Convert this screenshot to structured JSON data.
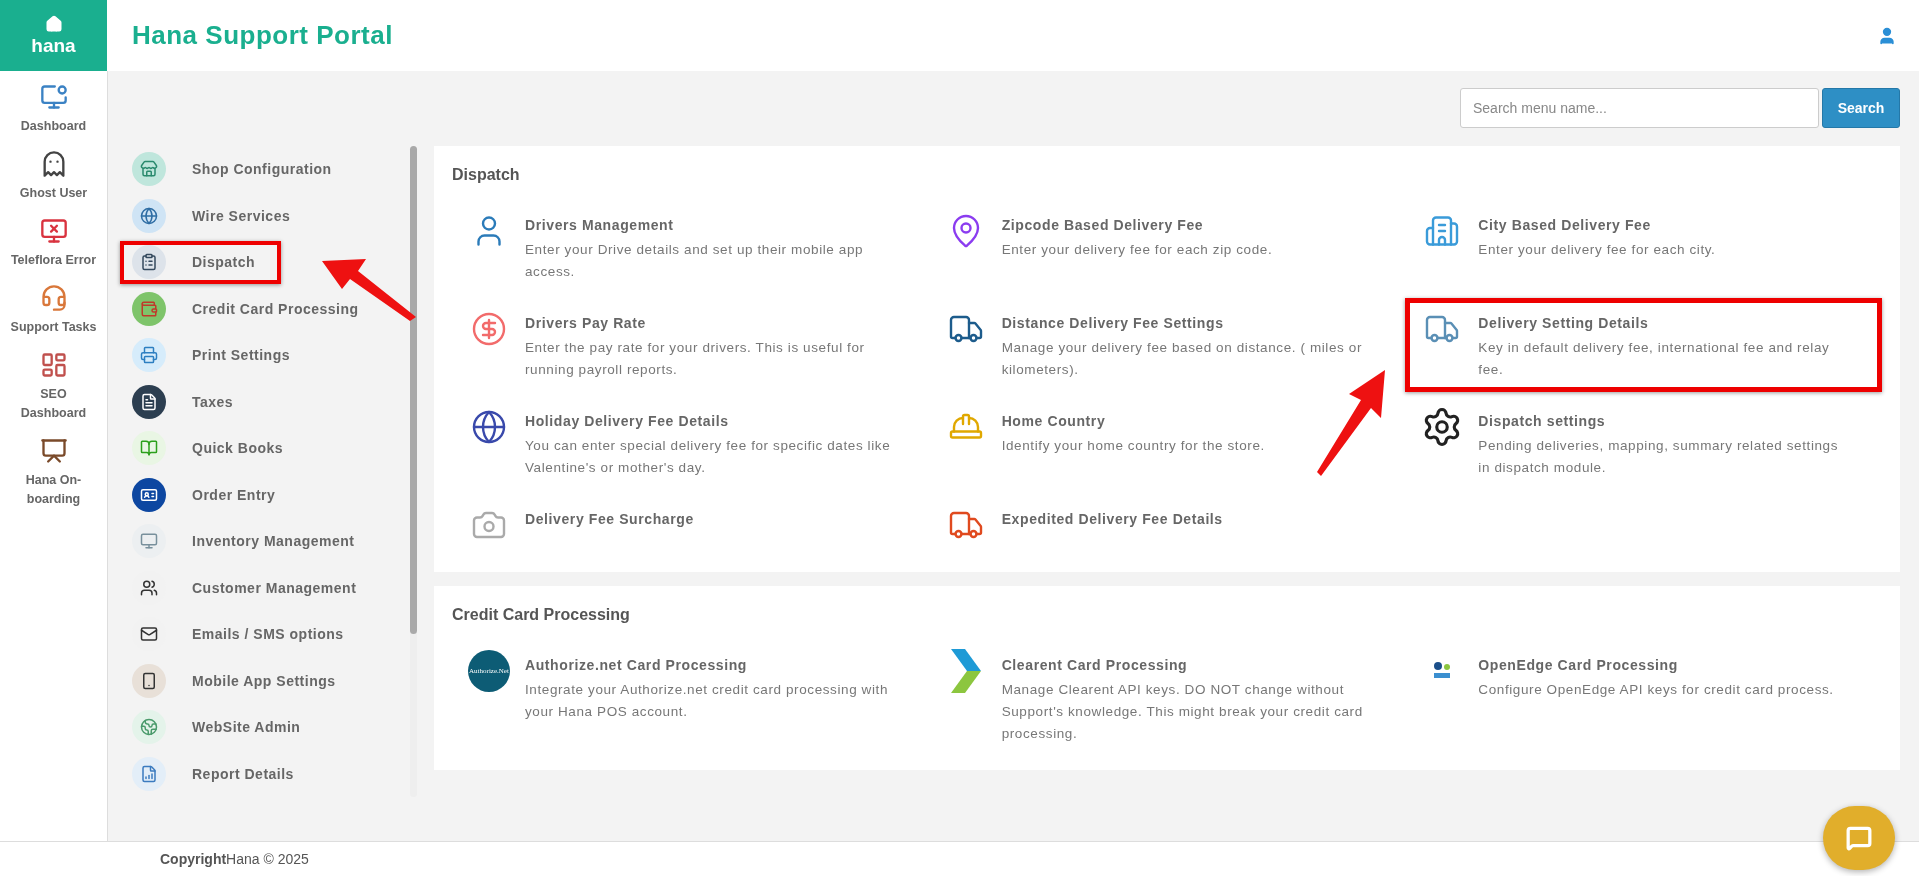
{
  "app": {
    "logo": "hana",
    "title": "Hana Support Portal"
  },
  "nav": [
    {
      "label": "Dashboard"
    },
    {
      "label": "Ghost User"
    },
    {
      "label": "Teleflora Error"
    },
    {
      "label": "Support Tasks"
    },
    {
      "label": "SEO\nDashboard"
    },
    {
      "label": "Hana On-boarding"
    }
  ],
  "search": {
    "placeholder": "Search menu name...",
    "button": "Search"
  },
  "sidebar": [
    {
      "label": "Shop Configuration",
      "highlighted": false
    },
    {
      "label": "Wire Services",
      "highlighted": false
    },
    {
      "label": "Dispatch",
      "highlighted": true
    },
    {
      "label": "Credit Card Processing",
      "highlighted": false
    },
    {
      "label": "Print Settings",
      "highlighted": false
    },
    {
      "label": "Taxes",
      "highlighted": false
    },
    {
      "label": "Quick Books",
      "highlighted": false
    },
    {
      "label": "Order Entry",
      "highlighted": false
    },
    {
      "label": "Inventory Management",
      "highlighted": false
    },
    {
      "label": "Customer Management",
      "highlighted": false
    },
    {
      "label": "Emails / SMS options",
      "highlighted": false
    },
    {
      "label": "Mobile App Settings",
      "highlighted": false
    },
    {
      "label": "WebSite Admin",
      "highlighted": false
    },
    {
      "label": "Report Details",
      "highlighted": false
    }
  ],
  "sections": [
    {
      "title": "Dispatch",
      "items": [
        {
          "title": "Drivers Management",
          "description": "Enter your Drive details and set up their mobile app access.",
          "highlighted": false
        },
        {
          "title": "Zipcode Based Delivery Fee",
          "description": "Enter your delivery fee for each zip code.",
          "highlighted": false
        },
        {
          "title": "City Based Delivery Fee",
          "description": "Enter your delivery fee for each city.",
          "highlighted": false
        },
        {
          "title": "Drivers Pay Rate",
          "description": "Enter the pay rate for your drivers. This is useful for running payroll reports.",
          "highlighted": false
        },
        {
          "title": "Distance Delivery Fee Settings",
          "description": "Manage your delivery fee based on distance. ( miles or kilometers).",
          "highlighted": false
        },
        {
          "title": "Delivery Setting Details",
          "description": "Key in default delivery fee, international fee and relay fee.",
          "highlighted": true
        },
        {
          "title": "Holiday Delivery Fee Details",
          "description": "You can enter special delivery fee for specific dates like Valentine's or mother's day.",
          "highlighted": false
        },
        {
          "title": "Home Country",
          "description": "Identify your home country for the store.",
          "highlighted": false
        },
        {
          "title": "Dispatch settings",
          "description": "Pending deliveries, mapping, summary related settings in dispatch module.",
          "highlighted": false
        },
        {
          "title": "Delivery Fee Surcharge",
          "highlighted": false
        },
        {
          "title": "Expedited Delivery Fee Details",
          "highlighted": false
        }
      ]
    },
    {
      "title": "Credit Card Processing",
      "items": [
        {
          "title": "Authorize.net Card Processing",
          "description": "Integrate your Authorize.net credit card processing with your Hana POS account.",
          "highlighted": false,
          "logo_text": "Authorize.Net"
        },
        {
          "title": "Clearent Card Processing",
          "description": "Manage Clearent API keys. DO NOT change without Support's knowledge. This might break your credit card processing.",
          "highlighted": false
        },
        {
          "title": "OpenEdge Card Processing",
          "description": "Configure OpenEdge API keys for credit card process.",
          "highlighted": false
        }
      ]
    }
  ],
  "footer": "**Copyright**Hana © 2025"
}
